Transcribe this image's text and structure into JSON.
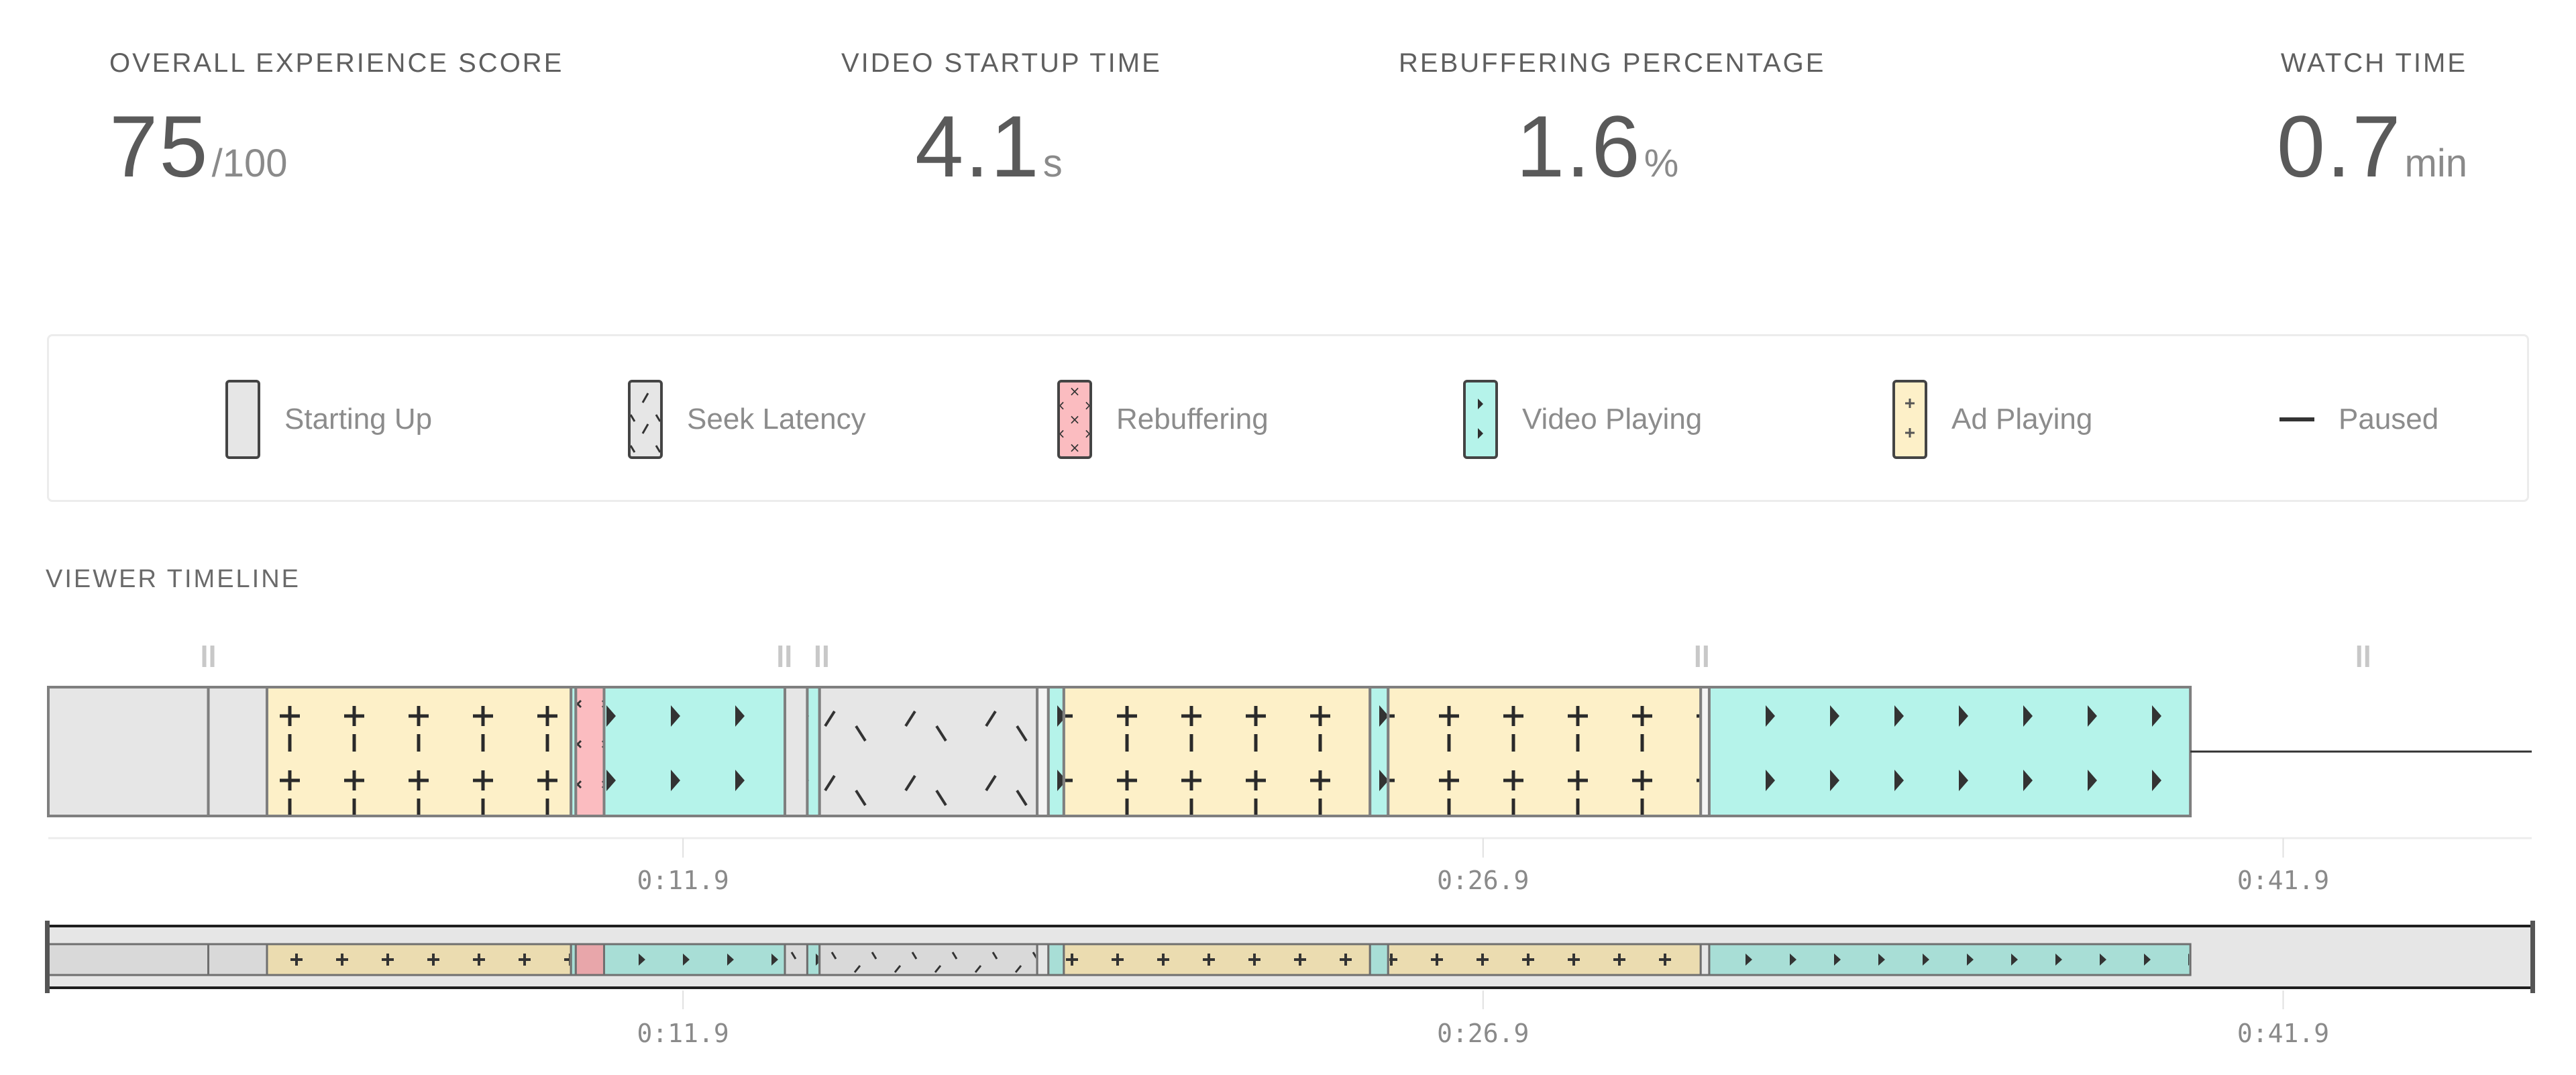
{
  "metrics": [
    {
      "label": "OVERALL EXPERIENCE SCORE",
      "value": "75",
      "unit": "/100"
    },
    {
      "label": "VIDEO STARTUP TIME",
      "value": "4.1",
      "unit": "s"
    },
    {
      "label": "REBUFFERING PERCENTAGE",
      "value": "1.6",
      "unit": "%"
    },
    {
      "label": "WATCH TIME",
      "value": "0.7",
      "unit": "min"
    }
  ],
  "legend": [
    {
      "key": "startup",
      "label": "Starting Up"
    },
    {
      "key": "seek",
      "label": "Seek Latency"
    },
    {
      "key": "rebuffer",
      "label": "Rebuffering"
    },
    {
      "key": "video",
      "label": "Video Playing"
    },
    {
      "key": "ad",
      "label": "Ad Playing"
    },
    {
      "key": "paused",
      "label": "Paused"
    }
  ],
  "colors": {
    "startup": "#e6e6e6",
    "seek": "#e6e6e6",
    "rebuffer": "#fbbcc0",
    "video": "#b5f3ea",
    "ad": "#fdf0c8",
    "gap": "#f4f4f4",
    "paused": "#333333",
    "border": "#7f7f7f",
    "glyph": "#2f2f2f"
  },
  "timeline": {
    "title": "VIEWER TIMELINE",
    "segments": [
      {
        "state": "startup",
        "start": 0.0,
        "end": 3.0
      },
      {
        "state": "startup",
        "start": 3.0,
        "end": 4.1
      },
      {
        "state": "ad",
        "start": 4.1,
        "end": 9.8
      },
      {
        "state": "video",
        "start": 9.8,
        "end": 9.89
      },
      {
        "state": "rebuffer",
        "start": 9.89,
        "end": 10.42
      },
      {
        "state": "video",
        "start": 10.42,
        "end": 13.81
      },
      {
        "state": "seek",
        "start": 13.81,
        "end": 14.23
      },
      {
        "state": "video",
        "start": 14.23,
        "end": 14.46
      },
      {
        "state": "seek",
        "start": 14.46,
        "end": 18.54
      },
      {
        "state": "gap",
        "start": 18.54,
        "end": 18.75
      },
      {
        "state": "video",
        "start": 18.75,
        "end": 19.04
      },
      {
        "state": "ad",
        "start": 19.04,
        "end": 24.78
      },
      {
        "state": "video",
        "start": 24.78,
        "end": 25.12
      },
      {
        "state": "ad",
        "start": 25.12,
        "end": 30.98
      },
      {
        "state": "gap",
        "start": 30.98,
        "end": 31.14
      },
      {
        "state": "video",
        "start": 31.14,
        "end": 40.16
      },
      {
        "state": "paused",
        "start": 40.16,
        "end": 46.56
      }
    ],
    "pause_markers": [
      3.0,
      13.8,
      14.5,
      31.0,
      43.4
    ],
    "ticks": [
      {
        "t": 11.9,
        "label": "0:11.9"
      },
      {
        "t": 26.9,
        "label": "0:26.9"
      },
      {
        "t": 41.9,
        "label": "0:41.9"
      }
    ],
    "domain": [
      0,
      46.56
    ]
  }
}
